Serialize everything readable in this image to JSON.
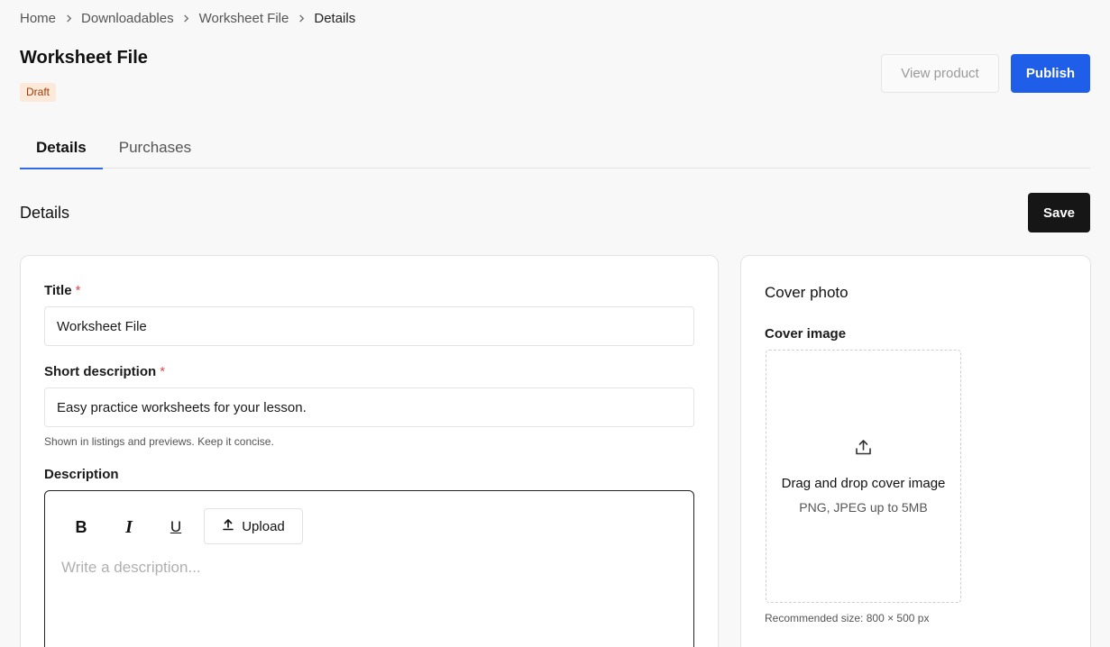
{
  "breadcrumb": {
    "items": [
      "Home",
      "Downloadables",
      "Worksheet File",
      "Details"
    ]
  },
  "header": {
    "title": "Worksheet File",
    "status": "Draft",
    "view_label": "View product",
    "publish_label": "Publish"
  },
  "tabs": [
    {
      "label": "Details",
      "active": true
    },
    {
      "label": "Purchases",
      "active": false
    }
  ],
  "section": {
    "title": "Details",
    "save_label": "Save"
  },
  "form": {
    "title_label": "Title",
    "title_value": "Worksheet File",
    "short_desc_label": "Short description",
    "short_desc_value": "Easy practice worksheets for your lesson.",
    "short_desc_help": "Shown in listings and previews. Keep it concise.",
    "required_mark": "*",
    "description_label": "Description",
    "toolbar": {
      "bold": "B",
      "italic": "I",
      "underline": "U",
      "upload_label": "Upload"
    },
    "description_placeholder": "Write a description..."
  },
  "cover": {
    "title": "Cover photo",
    "image_label": "Cover image",
    "drop_title": "Drag and drop cover image",
    "drop_sub": "PNG, JPEG up to 5MB",
    "help": "Recommended size: 800 × 500 px"
  },
  "colors": {
    "accent": "#1f5ee8",
    "save": "#161616",
    "badge_bg": "#fde9d9",
    "badge_text": "#9a3d0a",
    "required": "#e04b4b"
  }
}
